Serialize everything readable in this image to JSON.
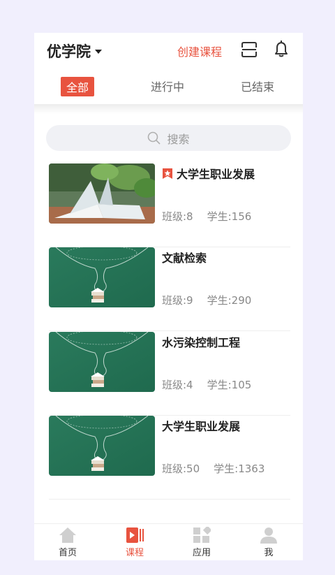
{
  "header": {
    "school_name": "优学院",
    "create_course": "创建课程",
    "scan_icon": "scan-icon",
    "bell_icon": "bell-icon"
  },
  "tabs": [
    {
      "label": "全部",
      "active": true
    },
    {
      "label": "进行中",
      "active": false
    },
    {
      "label": "已结束",
      "active": false
    }
  ],
  "search": {
    "placeholder": "搜索"
  },
  "courses": [
    {
      "title": "大学生职业发展",
      "class_count": "班级:8",
      "student_count": "学生:156",
      "starred": true,
      "thumb": "book-on-table"
    },
    {
      "title": "文献检索",
      "class_count": "班级:9",
      "student_count": "学生:290",
      "starred": false,
      "thumb": "green-chalkboard-book"
    },
    {
      "title": "水污染控制工程",
      "class_count": "班级:4",
      "student_count": "学生:105",
      "starred": false,
      "thumb": "green-chalkboard-book"
    },
    {
      "title": "大学生职业发展",
      "class_count": "班级:50",
      "student_count": "学生:1363",
      "starred": false,
      "thumb": "green-chalkboard-book"
    }
  ],
  "bottom_nav": [
    {
      "label": "首页",
      "icon": "home-icon",
      "active": false
    },
    {
      "label": "课程",
      "icon": "course-icon",
      "active": true
    },
    {
      "label": "应用",
      "icon": "apps-icon",
      "active": false
    },
    {
      "label": "我",
      "icon": "user-icon",
      "active": false
    }
  ],
  "colors": {
    "accent": "#e8533f",
    "background": "#f1effd"
  }
}
